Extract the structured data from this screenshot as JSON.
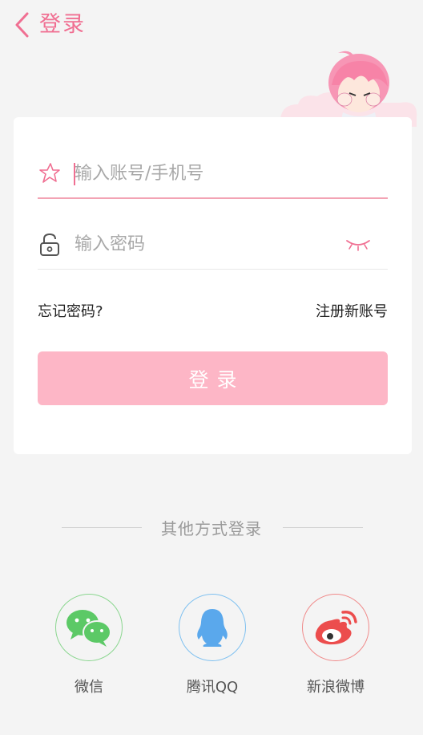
{
  "header": {
    "title": "登录",
    "back_icon": "chevron-left-icon"
  },
  "colors": {
    "accent": "#f06f92",
    "button_bg": "#fdb6c6",
    "wechat": "#5cc966",
    "qq": "#5aa8ec",
    "weibo": "#ec4d4d"
  },
  "form": {
    "account_placeholder": "输入账号/手机号",
    "account_value": "",
    "account_icon": "star-icon",
    "password_placeholder": "输入密码",
    "password_value": "",
    "password_icon": "lock-icon",
    "toggle_icon": "eye-closed-icon",
    "forgot_label": "忘记密码?",
    "register_label": "注册新账号",
    "login_label": "登录"
  },
  "other_login": {
    "title": "其他方式登录",
    "providers": [
      {
        "label": "微信",
        "icon": "wechat-icon"
      },
      {
        "label": "腾讯QQ",
        "icon": "qq-icon"
      },
      {
        "label": "新浪微博",
        "icon": "weibo-icon"
      }
    ]
  }
}
